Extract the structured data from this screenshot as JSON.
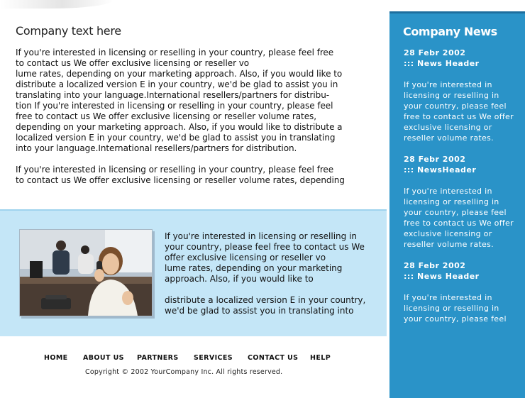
{
  "main": {
    "heading": "Company text here",
    "paragraph_1": "If you're interested in licensing or reselling  in your country, please feel free\nto contact us We offer exclusive licensing or reseller vo\nlume rates, depending on your marketing approach. Also, if you would like to\ndistribute a localized version E in your country, we'd be glad to assist you in\ntranslating  into your language.International resellers/partners for distribu-\ntion If you're interested in licensing or reselling  in your country, please feel\nfree to contact us We offer exclusive licensing or reseller volume rates,\ndepending on your marketing approach. Also, if you would like to distribute a\nlocalized version E in your country, we'd be glad to assist you in translating\ninto your language.International resellers/partners for distribution.",
    "paragraph_2": "If you're interested in licensing or reselling  in your country, please feel free\nto contact us We offer exclusive licensing or reseller volume rates, depending"
  },
  "band": {
    "text": "If you're interested in licensing or reselling  in\nyour country, please feel free to contact us We\noffer exclusive licensing or reseller vo\nlume rates, depending on your marketing\napproach. Also, if you would like to\n\ndistribute a localized version E in your country,\nwe'd be glad to assist you in translating  into"
  },
  "footer": {
    "nav": [
      "HOME",
      "ABOUT US",
      "PARTNERS",
      "SERVICES",
      "CONTACT US",
      "HELP"
    ],
    "copyright": "Copyright © 2002 YourCompany Inc. All rights reserved."
  },
  "sidebar": {
    "title": "Company News",
    "news": [
      {
        "date": "28 Febr 2002",
        "header": "::: News Header",
        "body": "If you're interested in\nlicensing or reselling  in\nyour country, please feel\nfree to contact us We offer\nexclusive licensing or\nreseller volume rates."
      },
      {
        "date": "28 Febr 2002",
        "header": "::: NewsHeader",
        "body": "If you're interested in\nlicensing or reselling  in\nyour country, please feel\nfree to contact us We offer\nexclusive licensing or\nreseller volume rates."
      },
      {
        "date": "28 Febr 2002",
        "header": "::: News Header",
        "body": "If you're interested in\nlicensing or reselling  in\nyour country, please feel"
      }
    ]
  },
  "colors": {
    "sidebar_blue": "#2a93c8",
    "band_light_blue": "#c4e6f7",
    "text": "#111111"
  }
}
